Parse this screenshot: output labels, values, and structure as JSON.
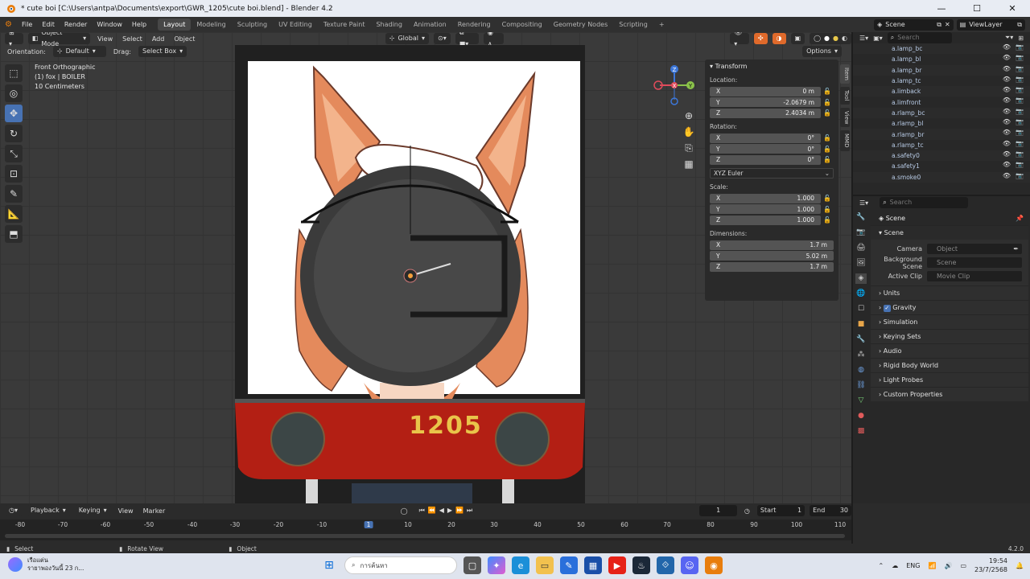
{
  "window": {
    "title": "* cute boi [C:\\Users\\antpa\\Documents\\export\\GWR_1205\\cute boi.blend] - Blender 4.2"
  },
  "menu": [
    "File",
    "Edit",
    "Render",
    "Window",
    "Help"
  ],
  "workspaces": [
    "Layout",
    "Modeling",
    "Sculpting",
    "UV Editing",
    "Texture Paint",
    "Shading",
    "Animation",
    "Rendering",
    "Compositing",
    "Geometry Nodes",
    "Scripting"
  ],
  "active_workspace": "Layout",
  "topright": {
    "scene": "Scene",
    "view_layer": "ViewLayer"
  },
  "viewport": {
    "mode": "Object Mode",
    "menus": [
      "View",
      "Select",
      "Add",
      "Object"
    ],
    "transform_orientation": "Global",
    "orientation_label": "Orientation:",
    "orientation_value": "Default",
    "drag_label": "Drag:",
    "drag_value": "Select Box",
    "options": "Options",
    "info": {
      "view": "Front Orthographic",
      "object": "(1) fox | BOILER",
      "scale": "10 Centimeters"
    },
    "number_plate": "1205",
    "gizmo": {
      "x": "X",
      "y": "Y",
      "z": "Z"
    }
  },
  "npanel": {
    "title": "Transform",
    "location_label": "Location:",
    "location": [
      {
        "axis": "X",
        "value": "0 m"
      },
      {
        "axis": "Y",
        "value": "-2.0679 m"
      },
      {
        "axis": "Z",
        "value": "2.4034 m"
      }
    ],
    "rotation_label": "Rotation:",
    "rotation": [
      {
        "axis": "X",
        "value": "0°"
      },
      {
        "axis": "Y",
        "value": "0°"
      },
      {
        "axis": "Z",
        "value": "0°"
      }
    ],
    "rotation_mode": "XYZ Euler",
    "scale_label": "Scale:",
    "scale": [
      {
        "axis": "X",
        "value": "1.000"
      },
      {
        "axis": "Y",
        "value": "1.000"
      },
      {
        "axis": "Z",
        "value": "1.000"
      }
    ],
    "dimensions_label": "Dimensions:",
    "dimensions": [
      {
        "axis": "X",
        "value": "1.7 m"
      },
      {
        "axis": "Y",
        "value": "5.02 m"
      },
      {
        "axis": "Z",
        "value": "1.7 m"
      }
    ],
    "tabs": [
      "Item",
      "Tool",
      "View",
      "MMD"
    ]
  },
  "outliner": {
    "search_placeholder": "Search",
    "items": [
      "a.lamp_bc",
      "a.lamp_bl",
      "a.lamp_br",
      "a.lamp_tc",
      "a.limback",
      "a.limfront",
      "a.rlamp_bc",
      "a.rlamp_bl",
      "a.rlamp_br",
      "a.rlamp_tc",
      "a.safety0",
      "a.safety1",
      "a.smoke0"
    ]
  },
  "properties": {
    "search_placeholder": "Search",
    "breadcrumb": "Scene",
    "panel": "Scene",
    "camera_label": "Camera",
    "camera_placeholder": "Object",
    "bg_label": "Background Scene",
    "bg_placeholder": "Scene",
    "clip_label": "Active Clip",
    "clip_placeholder": "Movie Clip",
    "sections": [
      "Units",
      "Gravity",
      "Simulation",
      "Keying Sets",
      "Audio",
      "Rigid Body World",
      "Light Probes",
      "Custom Properties"
    ]
  },
  "timeline": {
    "menus": [
      "Playback",
      "Keying",
      "View",
      "Marker"
    ],
    "current_frame": "1",
    "start_label": "Start",
    "start": "1",
    "end_label": "End",
    "end": "30",
    "ticks": [
      "-80",
      "-70",
      "-60",
      "-50",
      "-40",
      "-30",
      "-20",
      "-10",
      "1",
      "10",
      "20",
      "30",
      "40",
      "50",
      "60",
      "70",
      "80",
      "90",
      "100",
      "110"
    ]
  },
  "status": {
    "select": "Select",
    "rotate": "Rotate View",
    "object": "Object",
    "version": "4.2.0"
  },
  "taskbar": {
    "weather_line1": "เรือแต่น",
    "weather_line2": "รายาพองวันนี้ 23 ก...",
    "search_placeholder": "การค้นหา",
    "lang": "ENG",
    "time": "19:54",
    "date": "23/7/2568"
  }
}
